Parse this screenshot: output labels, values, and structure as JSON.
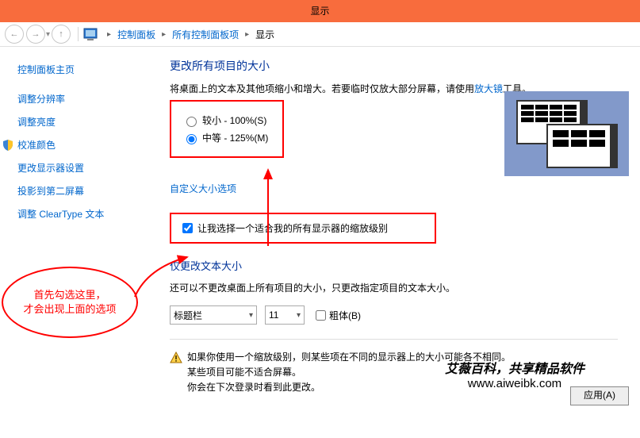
{
  "titlebar": "显示",
  "breadcrumbs": {
    "b0": "控制面板",
    "b1": "所有控制面板项",
    "b2": "显示"
  },
  "sidebar": {
    "home": "控制面板主页",
    "items": [
      "调整分辨率",
      "调整亮度",
      "校准颜色",
      "更改显示器设置",
      "投影到第二屏幕",
      "调整 ClearType 文本"
    ]
  },
  "main": {
    "h1": "更改所有项目的大小",
    "desc1_a": "将桌面上的文本及其他项缩小和增大。若要临时仅放大部分屏幕，请使用",
    "desc1_link": "放大镜",
    "desc1_b": "工具。",
    "radio_small": "较小 - 100%(S)",
    "radio_med": "中等 - 125%(M)",
    "custom_link": "自定义大小选项",
    "checkbox": "让我选择一个适合我的所有显示器的缩放级别",
    "h2": "仅更改文本大小",
    "desc2": "还可以不更改桌面上所有项目的大小，只更改指定项目的文本大小。",
    "dropdown1": "标题栏",
    "dropdown2": "11",
    "bold": "粗体(B)",
    "warn1": "如果你使用一个缩放级别，则某些项在不同的显示器上的大小可能各不相同。",
    "warn2": "某些项目可能不适合屏幕。",
    "warn3": "你会在下次登录时看到此更改。",
    "apply": "应用(A)"
  },
  "callout": {
    "l1": "首先勾选这里，",
    "l2": "才会出现上面的选项"
  },
  "watermark": {
    "l1": "艾薇百科，共享精品软件",
    "l2": "www.aiweibk.com"
  }
}
